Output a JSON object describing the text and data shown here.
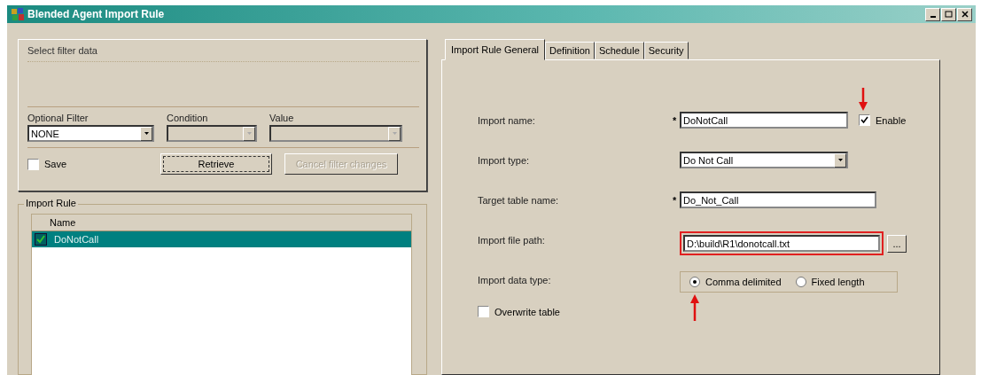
{
  "window": {
    "title": "Blended Agent Import Rule"
  },
  "filter": {
    "title": "Select filter data",
    "columns": [
      {
        "label": "Optional Filter",
        "value": "NONE",
        "disabled": false
      },
      {
        "label": "Condition",
        "disabled": true
      },
      {
        "label": "Value",
        "disabled": true
      }
    ],
    "save": {
      "label": "Save",
      "checked": false
    },
    "buttons": [
      {
        "label": "Retrieve",
        "disabled": false
      },
      {
        "label": "Cancel filter changes",
        "disabled": true
      }
    ]
  },
  "import_rule": {
    "title": "Import Rule",
    "column": "Name",
    "rows": [
      {
        "name": "DoNotCall",
        "checked": true,
        "selected": true
      }
    ]
  },
  "tabs": [
    {
      "label": "Import Rule General",
      "selected": true
    },
    {
      "label": "Definition",
      "selected": false
    },
    {
      "label": "Schedule",
      "selected": false
    },
    {
      "label": "Security",
      "selected": false
    }
  ],
  "form": {
    "import_name": {
      "label": "Import name:",
      "required": "*",
      "value": "DoNotCall"
    },
    "enable": {
      "label": "Enable",
      "checked": true,
      "marked": true
    },
    "import_type": {
      "label": "Import type:",
      "value": "Do Not Call"
    },
    "target_table": {
      "label": "Target table name:",
      "required": "*",
      "value": "Do_Not_Call"
    },
    "file_path": {
      "label": "Import file path:",
      "value": "D:\\build\\R1\\donotcall.txt",
      "highlighted": true,
      "browse": "..."
    },
    "data_type": {
      "label": "Import data type:",
      "options": [
        {
          "label": "Comma delimited",
          "selected": true,
          "marked": true
        },
        {
          "label": "Fixed length",
          "selected": false,
          "marked": false
        }
      ]
    },
    "overwrite": {
      "label": "Overwrite table",
      "checked": false
    }
  }
}
